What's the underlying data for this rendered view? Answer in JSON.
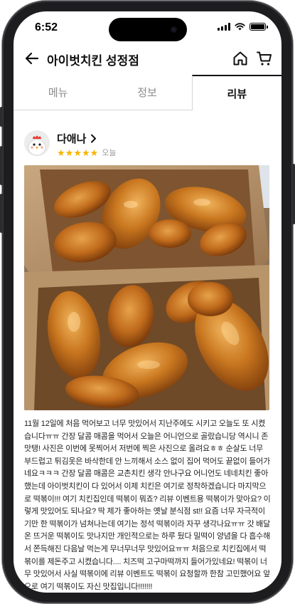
{
  "status_bar": {
    "time": "6:52"
  },
  "header": {
    "title": "아이벗치킨 성정점"
  },
  "tabs": [
    {
      "label": "메뉴",
      "active": false
    },
    {
      "label": "정보",
      "active": false
    },
    {
      "label": "리뷰",
      "active": true
    }
  ],
  "review": {
    "reviewer_name": "다애나",
    "rating": 5,
    "rating_max": 5,
    "date": "오늘",
    "text": "11월 12일에 처음 먹어보고 너무 맛있어서 지난주에도 시키고 오늘도 또 시켰습니다ㅠㅠ 간장 달콤 매콤을 먹어서 오늘은 어니언으로 골랐습니당 역시니 존맛탱! 사진은 이번에 못찍어서 저번에 찍은 사진으로 올려요ㅎㅎ 순살도 너무 부드럽고 튀김옷은 바삭한데 안 느끼해서 소스 없이 집어 먹어도 끝없이 들어가네요ㅋㅋㅋ 간장 달콤 매콤은 교촌치킨 생각 안나구요 어니언도 네네치킨 좋아했는데 아이벗치킨이 다 있어서 이제 치킨은 여기로 정착하겠습니다 마지막으로 떡볶이!!! 여기 치킨집인데 떡볶이 뭐죠? 리뷰 이벤트용 떡볶이가 맞아요? 이렇게 맛있어도 되나요? 딱 제가 좋아하는 옛날 분식점 st!! 요즘 너무 자극적이기만 한 떡볶이가 넘쳐나는데 여기는 정석 떡볶이라 자꾸 생각나요ㅠㅠ 갓 배달온 뜨거운 떡볶이도 맛나지만 개인적으로는 하루 뒀다 밀떡이 양념을 다 흡수해서 쫀득해진 다음날 먹는게 무너무너무 맛있어요ㅠㅠ 처음으로 치킨집에서 떡볶이를 제돈주고 시켰습니다.... 치즈떡 고구마떡까지 들어가있네요! 떡볶이 너무 맛있어서 사실 떡볶이에 리뷰 이벤트도 떡볶이 요청할까 한참 고민했어요 앞으로 여기 떡볶이도 자신 맛집입니다!!!!!!!"
  },
  "icons": {
    "back": "arrow-left-icon",
    "home": "home-icon",
    "cart": "cart-icon",
    "reviewer_chevron": "chevron-right-icon",
    "star": "star-icon"
  },
  "colors": {
    "star": "#f7b500",
    "active_tab": "#111111",
    "inactive_tab": "#8a8a8a"
  }
}
